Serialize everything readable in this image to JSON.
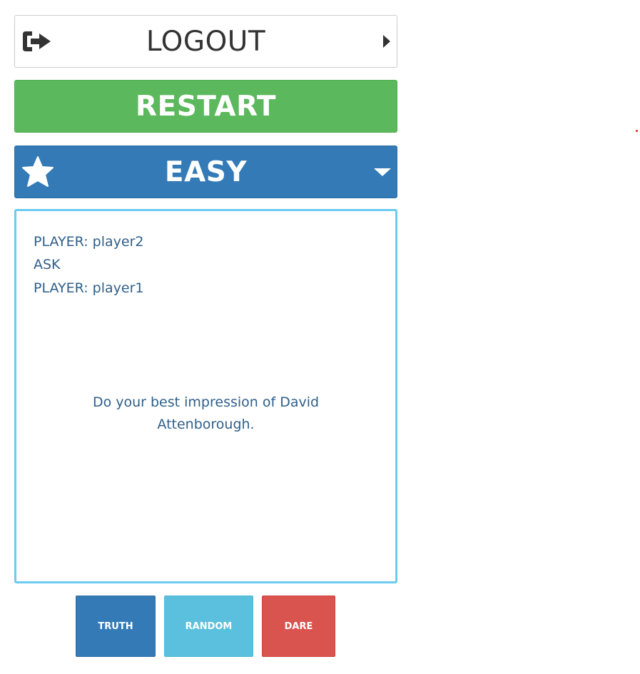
{
  "header": {
    "logout_label": "LOGOUT",
    "restart_label": "RESTART",
    "difficulty_label": "EASY"
  },
  "game": {
    "current_player_line": "PLAYER: player2",
    "action_line": "ASK",
    "target_player_line": "PLAYER: player1",
    "challenge_text": "Do your best impression of David Attenborough."
  },
  "actions": {
    "truth_label": "TRUTH",
    "random_label": "RANDOM",
    "dare_label": "DARE"
  },
  "colors": {
    "restart": "#5cb85c",
    "difficulty": "#337ab7",
    "panel_border": "#6ccbee",
    "text": "#2f5f8a",
    "truth": "#337ab7",
    "random": "#5bc0de",
    "dare": "#d9534f"
  },
  "icons": {
    "logout": "sign-out-icon",
    "logout_arrow": "caret-right-icon",
    "difficulty": "star-icon",
    "difficulty_arrow": "caret-down-icon"
  }
}
